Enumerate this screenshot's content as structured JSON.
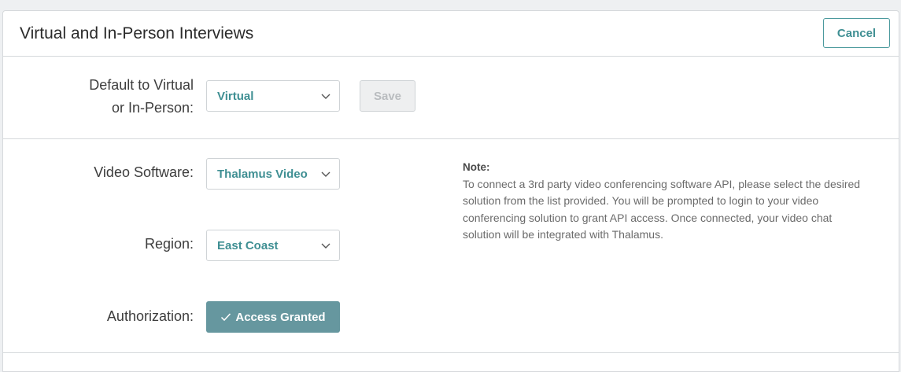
{
  "header": {
    "title": "Virtual and In-Person Interviews",
    "cancel_label": "Cancel"
  },
  "default_mode": {
    "label_line1": "Default to Virtual",
    "label_line2": "or In-Person:",
    "selected": "Virtual",
    "save_label": "Save"
  },
  "video": {
    "software_label": "Video Software:",
    "software_selected": "Thalamus Video",
    "region_label": "Region:",
    "region_selected": "East Coast",
    "auth_label": "Authorization:",
    "auth_button_label": "Access Granted"
  },
  "note": {
    "title": "Note:",
    "body": "To connect a 3rd party video conferencing software API, please select the desired solution from the list provided. You will be prompted to login to your video conferencing solution to grant API access. Once connected, your video chat solution will be integrated with Thalamus."
  },
  "colors": {
    "accent": "#3f8f93",
    "access_button": "#66979f",
    "border": "#d6d9dc"
  },
  "icons": {
    "select_chevron": "chevron-down-icon",
    "access_check": "checkmark-icon"
  }
}
